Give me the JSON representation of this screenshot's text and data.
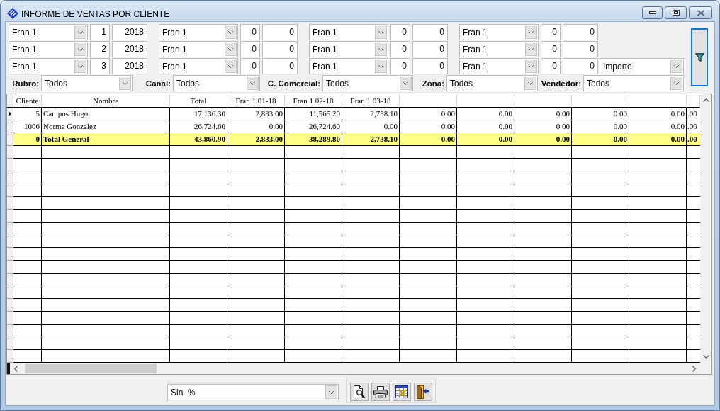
{
  "window": {
    "title": "INFORME DE VENTAS POR CLIENTE"
  },
  "period_rows": [
    {
      "groups": [
        {
          "series": "Fran 1",
          "month": "1",
          "year": "2018"
        },
        {
          "series": "Fran 1",
          "month": "0",
          "year": "0"
        },
        {
          "series": "Fran 1",
          "month": "0",
          "year": "0"
        },
        {
          "series": "Fran 1",
          "month": "0",
          "year": "0"
        }
      ]
    },
    {
      "groups": [
        {
          "series": "Fran 1",
          "month": "2",
          "year": "2018"
        },
        {
          "series": "Fran 1",
          "month": "0",
          "year": "0"
        },
        {
          "series": "Fran 1",
          "month": "0",
          "year": "0"
        },
        {
          "series": "Fran 1",
          "month": "0",
          "year": "0"
        }
      ]
    },
    {
      "groups": [
        {
          "series": "Fran 1",
          "month": "3",
          "year": "2018"
        },
        {
          "series": "Fran 1",
          "month": "0",
          "year": "0"
        },
        {
          "series": "Fran 1",
          "month": "0",
          "year": "0"
        },
        {
          "series": "Fran 1",
          "month": "0",
          "year": "0"
        }
      ],
      "measure_select": {
        "value": "Importe"
      }
    }
  ],
  "filters": [
    {
      "label": "Rubro:",
      "value": "Todos"
    },
    {
      "label": "Canal:",
      "value": "Todos"
    },
    {
      "label": "C. Comercial:",
      "value": "Todos"
    },
    {
      "label": "Zona:",
      "value": "Todos"
    },
    {
      "label": "Vendedor:",
      "value": "Todos"
    }
  ],
  "grid": {
    "columns": [
      "Cliente",
      "Nombre",
      "Total",
      "Fran 1 01-18",
      "Fran 1 02-18",
      "Fran 1 03-18"
    ],
    "rows": [
      {
        "selected": true,
        "kind": "data",
        "cells": [
          "5",
          "Campos Hugo",
          "17,136.30",
          "2,833.00",
          "11,565.20",
          "2,738.10",
          "0.00",
          "0.00",
          "0.00",
          "0.00",
          "0.00",
          ".00"
        ]
      },
      {
        "selected": false,
        "kind": "data",
        "cells": [
          "1006",
          "Norma Gonzalez",
          "26,724.60",
          "0.00",
          "26,724.60",
          "0.00",
          "0.00",
          "0.00",
          "0.00",
          "0.00",
          "0.00",
          ".00"
        ]
      },
      {
        "selected": false,
        "kind": "total",
        "cells": [
          "0",
          "Total General",
          "43,860.90",
          "2,833.00",
          "38,289.80",
          "2,738.10",
          "0.00",
          "0.00",
          "0.00",
          "0.00",
          "0.00",
          ".00"
        ]
      }
    ]
  },
  "percent_select": {
    "value": "Sin  %"
  }
}
